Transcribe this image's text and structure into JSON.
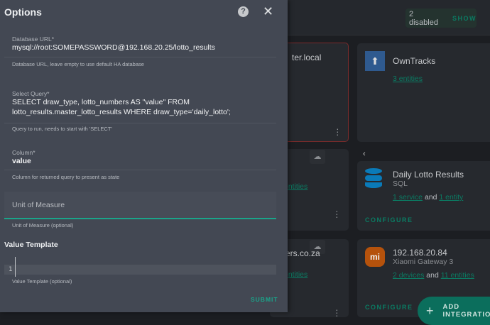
{
  "dialog": {
    "title": "Options",
    "help_icon": "?",
    "close_icon": "✕",
    "fields": [
      {
        "label": "Database URL*",
        "value": "mysql://root:SOMEPASSWORD@192.168.20.25/lotto_results",
        "helper": "Database URL, leave empty to use default HA database"
      },
      {
        "label": "Select Query*",
        "value": "SELECT draw_type, lotto_numbers AS \"value\" FROM lotto_results.master_lotto_results WHERE draw_type='daily_lotto';",
        "helper": "Query to run, needs to start with 'SELECT'"
      },
      {
        "label": "Column*",
        "value": "value",
        "helper": "Column for returned query to present as state"
      }
    ],
    "unit_of_measure": {
      "placeholder": "Unit of Measure",
      "helper": "Unit of Measure (optional)"
    },
    "value_template": {
      "heading": "Value Template",
      "line_number": "1",
      "helper": "Value Template (optional)"
    },
    "submit_label": "SUBMIT"
  },
  "background": {
    "disabled_chip": {
      "text": "2 disabled",
      "action": "SHOW"
    },
    "cards": [
      {
        "title": "ter.local"
      },
      {
        "title": "OwnTracks",
        "link1": "3 entities"
      },
      {
        "link1": "entities"
      },
      {
        "title": "Daily Lotto Results",
        "subtitle": "SQL",
        "link1": "1 service",
        "and": "and",
        "link2": "1 entity",
        "configure": "CONFIGURE"
      },
      {
        "title": "ers.co.za",
        "link1": "entities"
      },
      {
        "title": "192.168.20.84",
        "subtitle": "Xiaomi Gateway 3",
        "link1": "2 devices",
        "and": "and",
        "link2": "11 entities",
        "configure": "CONFIGURE"
      }
    ],
    "fab_label": "ADD INTEGRATION"
  },
  "colors": {
    "accent": "#1aa58a",
    "link": "#0b7b63",
    "dialog_bg": "#434853"
  }
}
